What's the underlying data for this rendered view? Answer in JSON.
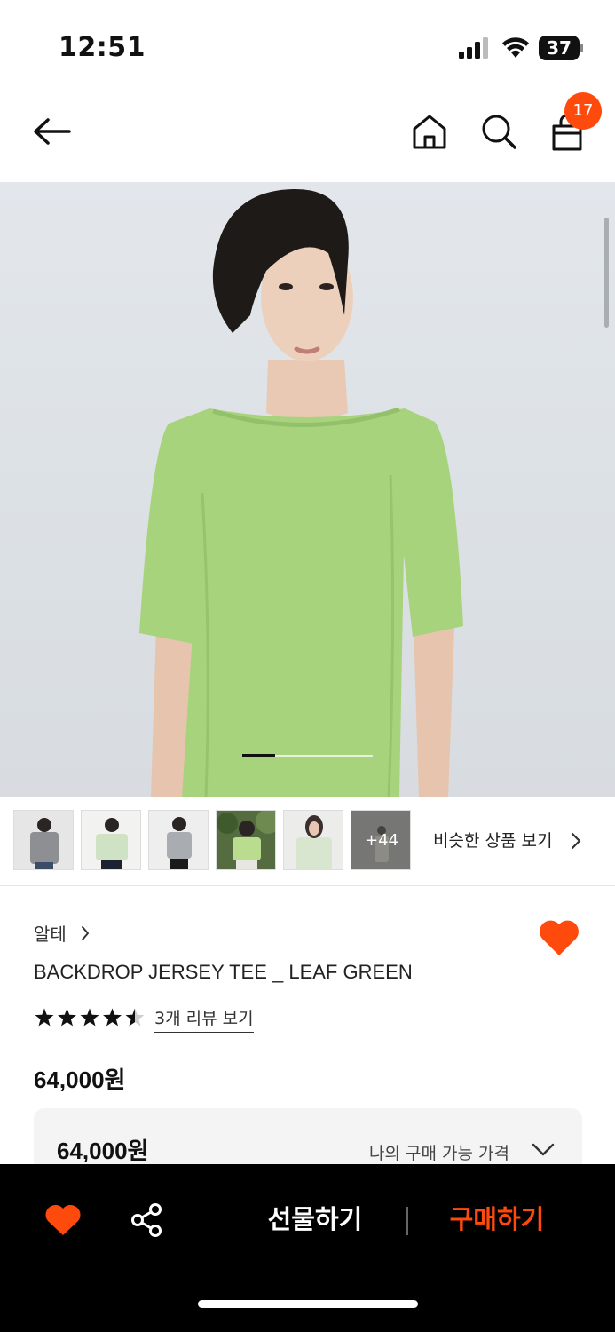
{
  "status_bar": {
    "time": "12:51",
    "battery_level": "37",
    "icons": [
      "signal-icon",
      "wifi-icon",
      "battery-icon"
    ]
  },
  "nav": {
    "icons": [
      "back-arrow-icon",
      "home-icon",
      "search-icon",
      "shopping-bag-icon"
    ],
    "cart_count": "17"
  },
  "gallery": {
    "image_count_progress": 0.25,
    "thumbnail_more": "+44",
    "similar_link": "비슷한 상품 보기"
  },
  "product": {
    "brand": "알테",
    "name": "BACKDROP JERSEY TEE _ LEAF GREEN",
    "rating": 4.5,
    "review_link": "3개 리뷰 보기",
    "price": "64,000원",
    "my_price": "64,000원",
    "my_price_label": "나의 구매 가능 가격"
  },
  "bottom_bar": {
    "gift_label": "선물하기",
    "buy_label": "구매하기"
  },
  "colors": {
    "accent": "#ff4a0e",
    "shirt": "#a8d37d",
    "bottom_bar": "#000000"
  }
}
